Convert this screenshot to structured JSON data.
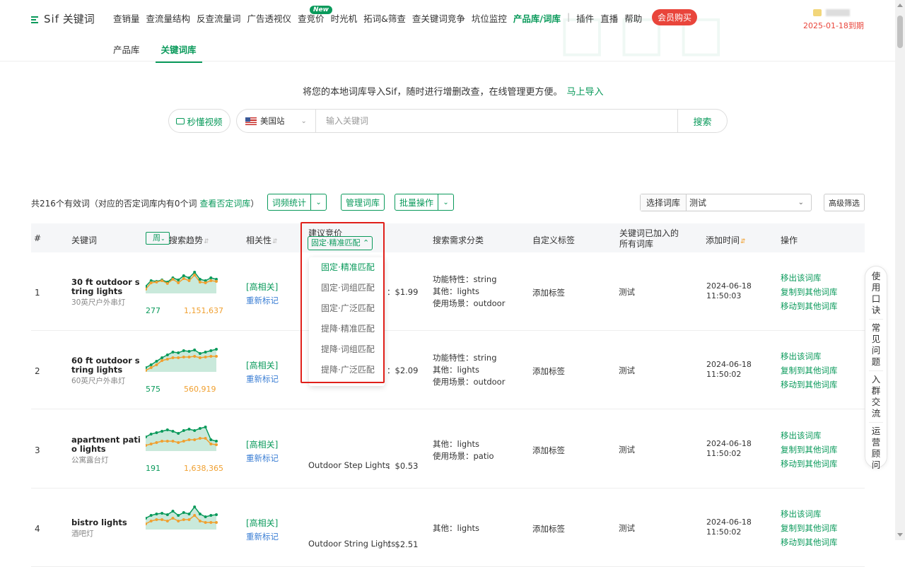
{
  "brand": {
    "name": "Sif",
    "sub": "关键词"
  },
  "nav": {
    "items": [
      "查销量",
      "查流量结构",
      "反查流量词",
      "广告透视仪",
      "查竞价",
      "时光机",
      "拓词&筛查",
      "查关键词竞争",
      "坑位监控",
      "产品库/词库",
      "|",
      "插件",
      "直播",
      "帮助"
    ],
    "new_badge": "New",
    "vip": "会员购买",
    "expire": "2025-01-18到期"
  },
  "subnav": {
    "product": "产品库",
    "keyword": "关键词库"
  },
  "import": {
    "text": "将您的本地词库导入Sif，随时进行增删改查，在线管理更方便。",
    "link": "马上导入"
  },
  "search": {
    "video": "秒懂视频",
    "site": "美国站",
    "placeholder": "输入关键词",
    "button": "搜索"
  },
  "toolbar": {
    "summary_a": "共216个有效词（对应的否定词库内有0个词",
    "summary_link": "查看否定词库",
    "summary_b": "）",
    "freq": "词频统计",
    "manage": "管理词库",
    "batch": "批量操作",
    "lib_label": "选择词库",
    "lib_value": "测试",
    "advanced": "高级筛选"
  },
  "table": {
    "headers": {
      "num": "#",
      "kw": "关键词",
      "period": "周",
      "trend": "搜索趋势",
      "rel": "相关性",
      "bid": "建议竞价",
      "bid_tag": "固定·精准匹配",
      "demand": "搜索需求分类",
      "tag": "自定义标签",
      "libs1": "关键词已加入的",
      "libs2": "所有词库",
      "time": "添加时间",
      "ops": "操作"
    },
    "rows": [
      {
        "n": "1",
        "kw": "30 ft outdoor string lights",
        "cn": "30英尺户外串灯",
        "a": "277",
        "b": "1,151,637",
        "rel": "[高相关]",
        "remark": "重新标记",
        "price": "$1.99",
        "demand": [
          "功能特性：string",
          "其他：lights",
          "使用场景：outdoor"
        ],
        "tag": "添加标签",
        "lib": "测试",
        "date": "2024-06-18",
        "time": "11:50:03"
      },
      {
        "n": "2",
        "kw": "60 ft outdoor string lights",
        "cn": "60英尺户外串灯",
        "a": "575",
        "b": "560,919",
        "rel": "[高相关]",
        "remark": "重新标记",
        "price": "$2.09",
        "demand": [
          "功能特性：string",
          "其他：lights",
          "使用场景：outdoor"
        ],
        "tag": "添加标签",
        "lib": "测试",
        "date": "2024-06-18",
        "time": "11:50:02"
      },
      {
        "n": "3",
        "kw": "apartment patio lights",
        "cn": "公寓露台灯",
        "a": "191",
        "b": "1,638,365",
        "rel": "[高相关]",
        "remark": "重新标记",
        "prod": "Outdoor Step Lights",
        "price": "$0.53",
        "demand": [
          "其他：lights",
          "使用场景：patio"
        ],
        "tag": "添加标签",
        "lib": "测试",
        "date": "2024-06-18",
        "time": "11:50:02"
      },
      {
        "n": "4",
        "kw": "bistro lights",
        "cn": "酒吧灯",
        "rel": "[高相关]",
        "remark": "重新标记",
        "prod": "Outdoor String Lights",
        "price": "$2.51",
        "demand": [
          "其他：lights"
        ],
        "tag": "添加标签",
        "lib": "测试",
        "date": "2024-06-18",
        "time": "11:50:02"
      }
    ],
    "ops": [
      "移出该词库",
      "复制到其他词库",
      "移动到其他词库"
    ]
  },
  "dropdown": [
    "固定·精准匹配",
    "固定·词组匹配",
    "固定·广泛匹配",
    "提降·精准匹配",
    "提降·词组匹配",
    "提降·广泛匹配"
  ],
  "float": [
    "使用口诀",
    "常见问题",
    "入群交流",
    "运营顾问"
  ],
  "colors": {
    "accent": "#0a9a5b",
    "red": "#e0201a",
    "orange": "#f0a030"
  }
}
